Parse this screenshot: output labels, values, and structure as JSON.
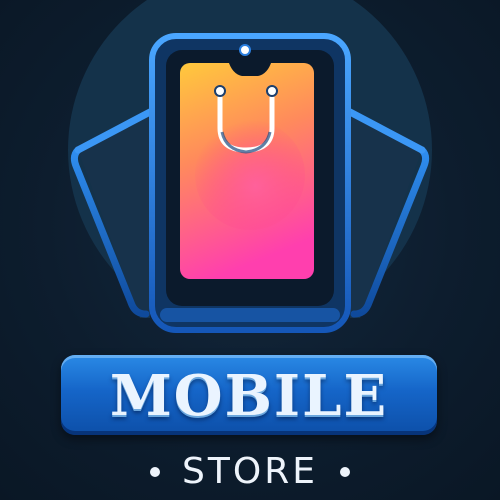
{
  "logo": {
    "icon": "smartphone-with-shopping-bag-icon",
    "title": "MOBILE",
    "subtitle": "STORE",
    "colors": {
      "background": "#0c1b2b",
      "phone_frame": "#1f7be0",
      "screen_top": "#ffc93c",
      "screen_bottom": "#ff3fae",
      "banner": "#1565c8",
      "text": "#eef4fb"
    }
  }
}
